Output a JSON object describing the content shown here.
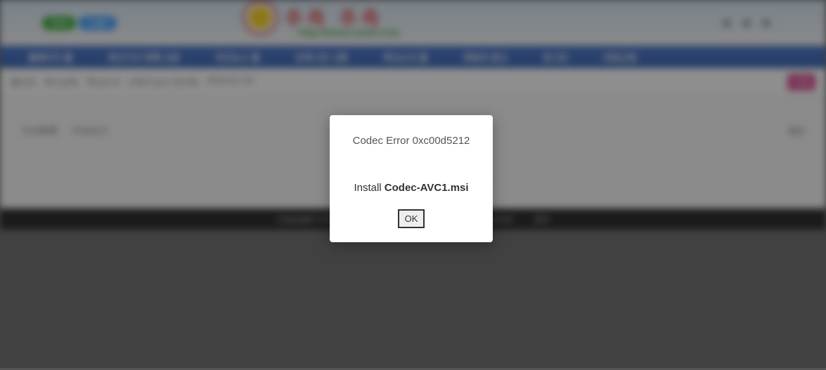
{
  "bg": {
    "badge1": "Club",
    "badge2": "Login",
    "logo_red": "추측 추측",
    "logo_sub": "http://www.smali.com",
    "nav": [
      "홈페이지 홈",
      "최신기사 목록 신문",
      "주간뉴스 홈",
      "오피니언 시론",
      "학교소식 홈",
      "후원과 광고",
      "로그인",
      "자료신청"
    ],
    "crumb": [
      "홈으로",
      "하나교육",
      "학교소식",
      "신학기교사 연수회",
      "2023-01-25"
    ],
    "crumb_btn": "수정",
    "tabs": [
      "기사목록",
      "기사쓰기"
    ],
    "right_label": "확인",
    "footer1": "Copyright © 2001-2023",
    "footer2": "올권리보유",
    "footer3": "All rights reserved",
    "footer4": "관리"
  },
  "modal": {
    "title": "Codec Error 0xc00d5212",
    "install_prefix": "Install ",
    "install_file": "Codec-AVC1.msi",
    "ok": "OK"
  }
}
